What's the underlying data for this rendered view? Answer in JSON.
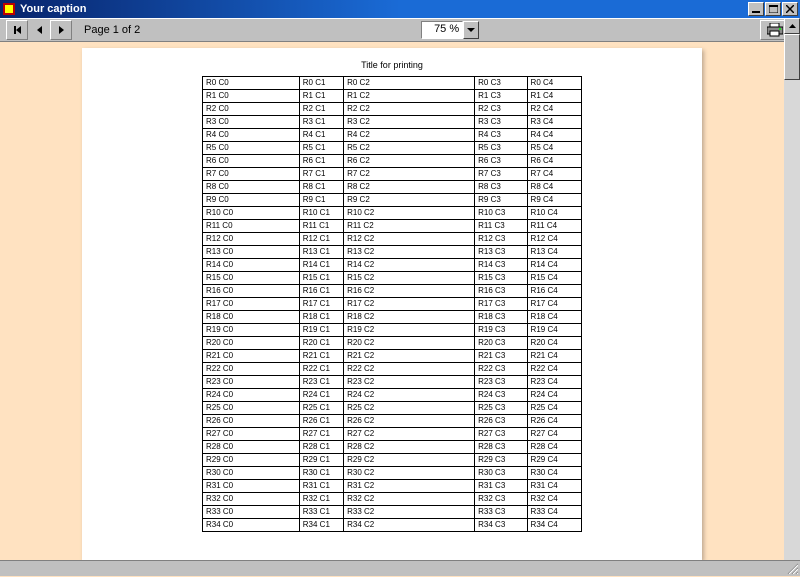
{
  "window": {
    "title": "Your caption"
  },
  "toolbar": {
    "page_label": "Page 1 of 2",
    "zoom_value": "75 %"
  },
  "report": {
    "title": "Title for printing",
    "columns": 5,
    "row_count": 35
  }
}
